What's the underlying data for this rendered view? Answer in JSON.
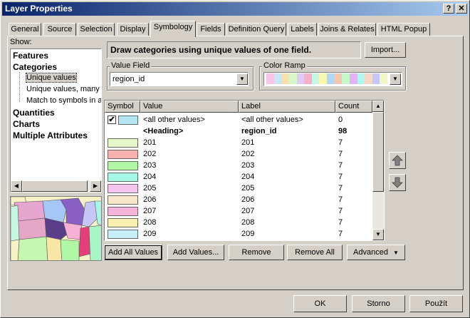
{
  "window": {
    "title": "Layer Properties"
  },
  "tabs": [
    "General",
    "Source",
    "Selection",
    "Display",
    "Symbology",
    "Fields",
    "Definition Query",
    "Labels",
    "Joins & Relates",
    "HTML Popup"
  ],
  "show_label": "Show:",
  "show_tree": {
    "features": "Features",
    "categories": "Categories",
    "sub": [
      "Unique values",
      "Unique values, many f",
      "Match to symbols in a"
    ],
    "quantities": "Quantities",
    "charts": "Charts",
    "multiple": "Multiple Attributes"
  },
  "description": "Draw categories using unique values of one field.",
  "import_label": "Import...",
  "value_field": {
    "label": "Value Field",
    "value": "region_id"
  },
  "color_ramp": {
    "label": "Color Ramp",
    "colors": [
      "#f7c6e6",
      "#c9e6f7",
      "#f7e0b0",
      "#d7f7c6",
      "#e0c9f7",
      "#f7b0c6",
      "#c6f7e6",
      "#f7f7b0",
      "#b0d7f7",
      "#f7c6b0",
      "#c6f7c6",
      "#e6b0f7",
      "#b0f7f0",
      "#f7d7c6",
      "#c6c6f7",
      "#f0f7c6"
    ]
  },
  "grid": {
    "headers": [
      "Symbol",
      "Value",
      "Label",
      "Count"
    ],
    "rows": [
      {
        "color": "#b3e6f2",
        "value": "<all other values>",
        "label": "<all other values>",
        "count": "0",
        "checked": true
      },
      {
        "color": "",
        "value": "<Heading>",
        "label": "region_id",
        "count": "98",
        "heading": true
      },
      {
        "color": "#e6f7c9",
        "value": "201",
        "label": "201",
        "count": "7"
      },
      {
        "color": "#f7b0ad",
        "value": "202",
        "label": "202",
        "count": "7"
      },
      {
        "color": "#b3f7a6",
        "value": "203",
        "label": "203",
        "count": "7"
      },
      {
        "color": "#a6f7e6",
        "value": "204",
        "label": "204",
        "count": "7"
      },
      {
        "color": "#f7c6f0",
        "value": "205",
        "label": "205",
        "count": "7"
      },
      {
        "color": "#f7e6c9",
        "value": "206",
        "label": "206",
        "count": "7"
      },
      {
        "color": "#f7b3d9",
        "value": "207",
        "label": "207",
        "count": "7"
      },
      {
        "color": "#f7f0b0",
        "value": "208",
        "label": "208",
        "count": "7"
      },
      {
        "color": "#c6eef7",
        "value": "209",
        "label": "209",
        "count": "7"
      }
    ]
  },
  "buttons": {
    "add_all": "Add All Values",
    "add_values": "Add Values...",
    "remove": "Remove",
    "remove_all": "Remove All",
    "advanced": "Advanced",
    "ok": "OK",
    "cancel": "Storno",
    "apply": "Použít"
  }
}
